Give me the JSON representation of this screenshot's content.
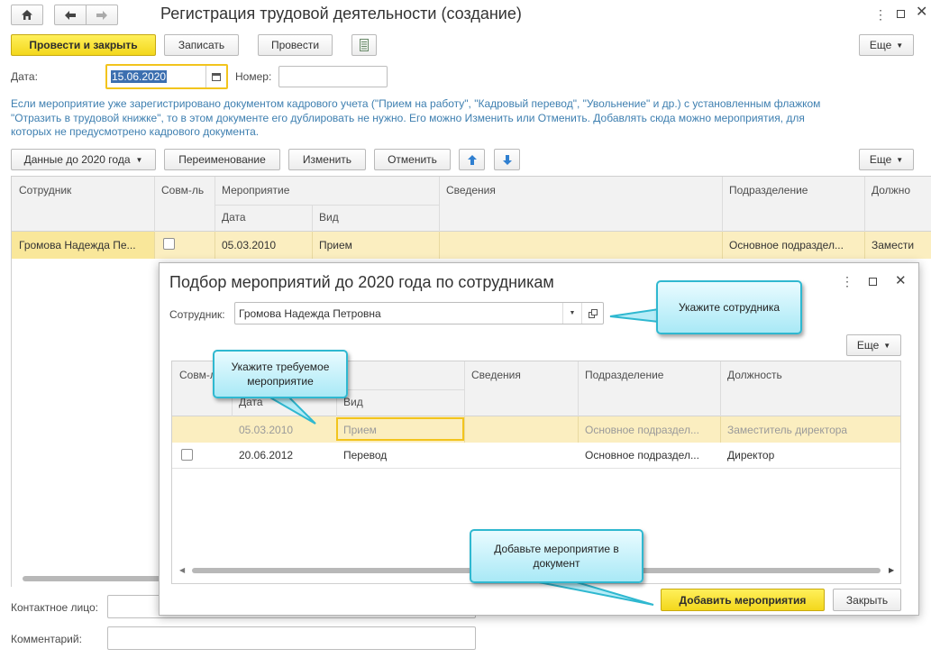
{
  "window": {
    "title": "Регистрация трудовой деятельности (создание)"
  },
  "toolbar": {
    "post_close": "Провести и закрыть",
    "save": "Записать",
    "post": "Провести",
    "more": "Еще"
  },
  "form": {
    "date_label": "Дата:",
    "date_value": "15.06.2020",
    "number_label": "Номер:",
    "number_value": "",
    "info_text": "Если мероприятие уже зарегистрировано документом кадрового учета (\"Прием на работу\", \"Кадровый перевод\", \"Увольнение\" и др.) с установленным флажком \"Отразить в трудовой книжке\", то в этом документе его дублировать не нужно. Его можно Изменить или Отменить. Добавлять сюда можно мероприятия, для которых не предусмотрено кадрового документа.",
    "contact_label": "Контактное лицо:",
    "comment_label": "Комментарий:"
  },
  "table_toolbar": {
    "data_before_2020": "Данные до 2020 года",
    "rename": "Переименование",
    "change": "Изменить",
    "cancel": "Отменить",
    "more": "Еще"
  },
  "main_table": {
    "headers": {
      "employee": "Сотрудник",
      "combined": "Совм-ль",
      "event": "Мероприятие",
      "date": "Дата",
      "kind": "Вид",
      "info": "Сведения",
      "department": "Подразделение",
      "position": "Должно"
    },
    "rows": [
      {
        "employee": "Громова Надежда Пе...",
        "date": "05.03.2010",
        "kind": "Прием",
        "info": "",
        "department": "Основное подраздел...",
        "position": "Замести"
      }
    ]
  },
  "dialog": {
    "title": "Подбор мероприятий до 2020 года по сотрудникам",
    "employee_label": "Сотрудник:",
    "employee_value": "Громова Надежда Петровна",
    "more": "Еще",
    "headers": {
      "combined": "Совм-л",
      "date": "Дата",
      "kind": "Вид",
      "info": "Сведения",
      "department": "Подразделение",
      "position": "Должность"
    },
    "rows": [
      {
        "date": "05.03.2010",
        "kind": "Прием",
        "department": "Основное подраздел...",
        "position": "Заместитель директора"
      },
      {
        "date": "20.06.2012",
        "kind": "Перевод",
        "department": "Основное подраздел...",
        "position": "Директор"
      }
    ],
    "add_button": "Добавить мероприятия",
    "close_button": "Закрыть"
  },
  "callouts": {
    "employee": "Укажите сотрудника",
    "event": "Укажите требуемое мероприятие",
    "add": "Добавьте мероприятие в документ"
  },
  "colors": {
    "accent_yellow": "#f7e03a",
    "selected_row": "#fbeec0",
    "info_text": "#3e7fb0",
    "callout_border": "#2fb8d0"
  }
}
